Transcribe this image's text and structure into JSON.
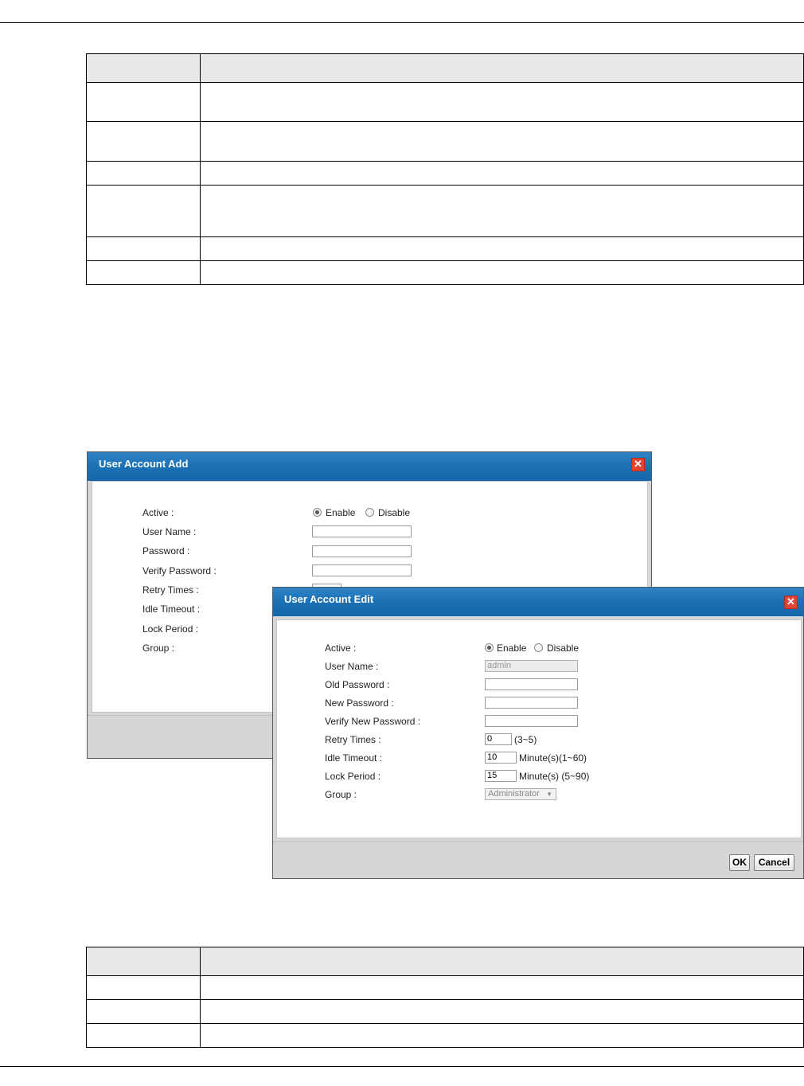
{
  "add_dialog": {
    "title": "User Account Add",
    "labels": {
      "active": "Active :",
      "user_name": "User Name :",
      "password": "Password :",
      "verify_password": "Verify Password :",
      "retry_times": "Retry Times :",
      "idle_timeout": "Idle Timeout :",
      "lock_period": "Lock Period :",
      "group": "Group :"
    },
    "enable_label": "Enable",
    "disable_label": "Disable",
    "active_selected": "Enable",
    "user_name_value": "",
    "password_value": "",
    "verify_password_value": ""
  },
  "edit_dialog": {
    "title": "User Account Edit",
    "labels": {
      "active": "Active :",
      "user_name": "User Name :",
      "old_password": "Old Password :",
      "new_password": "New Password :",
      "verify_new_password": "Verify New Password :",
      "retry_times": "Retry Times :",
      "idle_timeout": "Idle Timeout :",
      "lock_period": "Lock Period :",
      "group": "Group :"
    },
    "enable_label": "Enable",
    "disable_label": "Disable",
    "active_selected": "Enable",
    "user_name_value": "admin",
    "old_password_value": "",
    "new_password_value": "",
    "verify_new_password_value": "",
    "retry_times_value": "0",
    "retry_times_range": "(3~5)",
    "idle_timeout_value": "10",
    "idle_timeout_unit": "Minute(s)(1~60)",
    "lock_period_value": "15",
    "lock_period_unit": "Minute(s) (5~90)",
    "group_value": "Administrator",
    "ok_label": "OK",
    "cancel_label": "Cancel"
  },
  "icons": {
    "close": "close-icon",
    "dropdown": "chevron-down-icon"
  },
  "colors": {
    "titlebar": "#1a6fb3",
    "close": "#e04434",
    "dialog_bg": "#d6d6d6"
  }
}
